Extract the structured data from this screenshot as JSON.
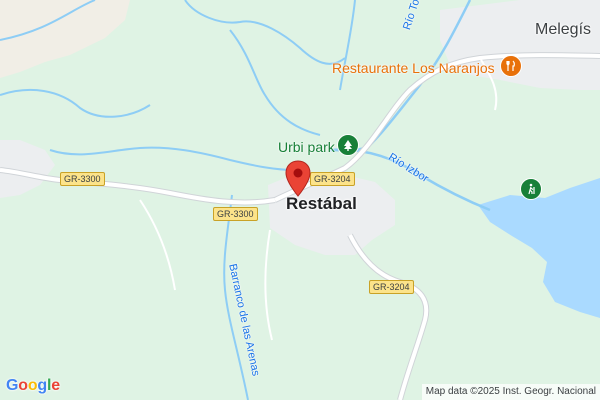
{
  "map": {
    "towns": {
      "main": "Restábal",
      "secondary": "Melegís"
    },
    "pois": {
      "restaurant": "Restaurante Los Naranjos",
      "park": "Urbi park"
    },
    "rivers": {
      "torrente": "Río Torrente",
      "izbor": "Río Izbor",
      "barranco": "Barranco de las Arenas"
    },
    "roads": {
      "gr3300_a": "GR-3300",
      "gr3300_b": "GR-3300",
      "gr3204_a": "GR-3204",
      "gr3204_b": "GR-3204"
    },
    "attribution": "Map data ©2025 Inst. Geogr. Nacional",
    "logo": {
      "g1": "G",
      "o1": "o",
      "o2": "o",
      "g2": "g",
      "l": "l",
      "e": "e"
    },
    "colors": {
      "land": "#dff3e4",
      "water": "#aadaff",
      "river": "#8ecdf5",
      "road": "#ffffff",
      "urban": "#eef0f2",
      "pin": "#ea4335",
      "restaurant": "#e8710a",
      "park": "#188038"
    },
    "icons": {
      "restaurant": "fork-knife-icon",
      "park": "tree-icon",
      "hiking": "hiker-icon",
      "pin": "location-pin-icon"
    }
  }
}
